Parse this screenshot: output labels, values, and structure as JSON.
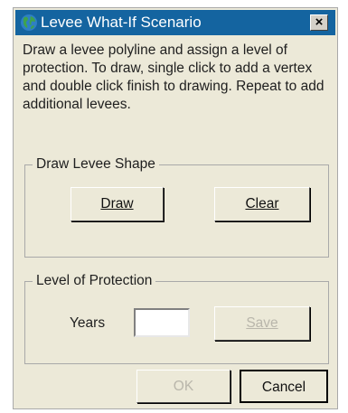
{
  "window": {
    "title": "Levee What-If Scenario",
    "close_glyph": "×",
    "icon": "globe-icon"
  },
  "instructions": "Draw a levee polyline and assign a level of protection.  To draw, single click to add a vertex and double click finish to drawing.  Repeat to add additional levees.",
  "draw_group": {
    "legend": "Draw Levee Shape",
    "draw_button": "Draw",
    "clear_button": "Clear"
  },
  "level_group": {
    "legend": "Level of Protection",
    "years_label": "Years",
    "years_value": "",
    "save_button": "Save",
    "save_enabled": false
  },
  "footer": {
    "ok_button": "OK",
    "ok_enabled": false,
    "cancel_button": "Cancel"
  },
  "colors": {
    "titlebar": "#1464a0",
    "dialog_background": "#ece9d8",
    "disabled_text": "#b9b6ab"
  }
}
